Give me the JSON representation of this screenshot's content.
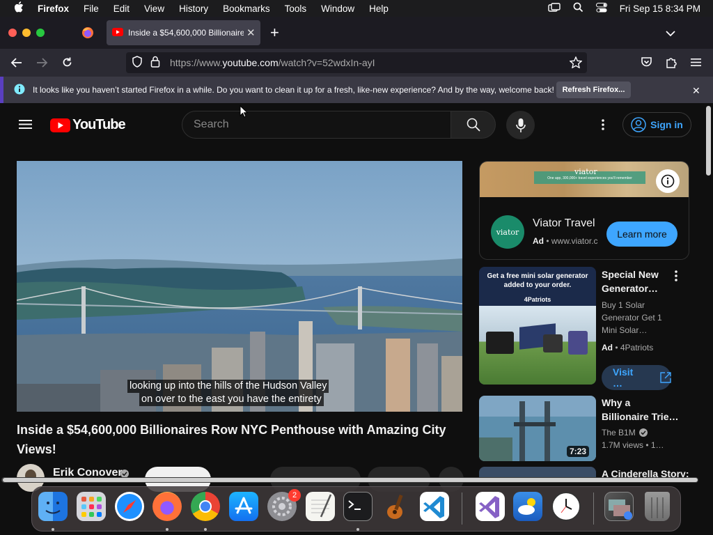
{
  "menubar": {
    "apple_icon": "apple-logo",
    "app_name": "Firefox",
    "items": [
      "File",
      "Edit",
      "View",
      "History",
      "Bookmarks",
      "Tools",
      "Window",
      "Help"
    ],
    "datetime": "Fri Sep 15  8:34 PM"
  },
  "browser": {
    "tab_title": "Inside a $54,600,000 Billionaire",
    "url_prefix": "https://www.",
    "url_host": "youtube.com",
    "url_path": "/watch?v=52wdxIn-ayI",
    "notification_text": "It looks like you haven’t started Firefox in a while. Do you want to clean it up for a fresh, like-new experience? And by the way, welcome back!",
    "refresh_label": "Refresh Firefox..."
  },
  "youtube": {
    "logo_text": "YouTube",
    "search_placeholder": "Search",
    "signin_label": "Sign in",
    "caption_line1": "looking up into the hills of the Hudson Valley",
    "caption_line2": "on over to the east you have the entirety",
    "video_title_line1": "Inside a $54,600,000 Billionaires Row NYC Penthouse with Amazing City",
    "video_title_line2": "Views!",
    "channel_name": "Erik Conover",
    "ad": {
      "banner_brand": "viator",
      "banner_tagline": "One app, 300,000+ travel experiences you'll remember",
      "logo_text": "viator",
      "name": "Viator Travel",
      "badge": "Ad",
      "url": "www.viator.c",
      "cta": "Learn more"
    },
    "sidebar": [
      {
        "thumb_text_line1": "Get a free mini solar generator",
        "thumb_text_line2": "added to your order.",
        "thumb_brand": "4Patriots",
        "title_line1": "Special New",
        "title_line2": "Generator…",
        "desc_line1": "Buy 1 Solar",
        "desc_line2": "Generator Get 1",
        "desc_line3": "Mini Solar…",
        "badge": "Ad",
        "advertiser": "4Patriots",
        "cta": "Visit …"
      },
      {
        "duration": "7:23",
        "title_line1": "Why a",
        "title_line2": "Billionaire Trie…",
        "channel": "The B1M",
        "meta": "1.7M views  • 1…"
      },
      {
        "title_line1": "A Cinderella Story:"
      }
    ]
  },
  "dock": {
    "settings_badge": "2"
  },
  "colors": {
    "youtube_red": "#ff0000",
    "link_blue": "#3ea6ff",
    "cta_blue": "#3ea6ff",
    "firefox_orange": "#ff7139"
  }
}
